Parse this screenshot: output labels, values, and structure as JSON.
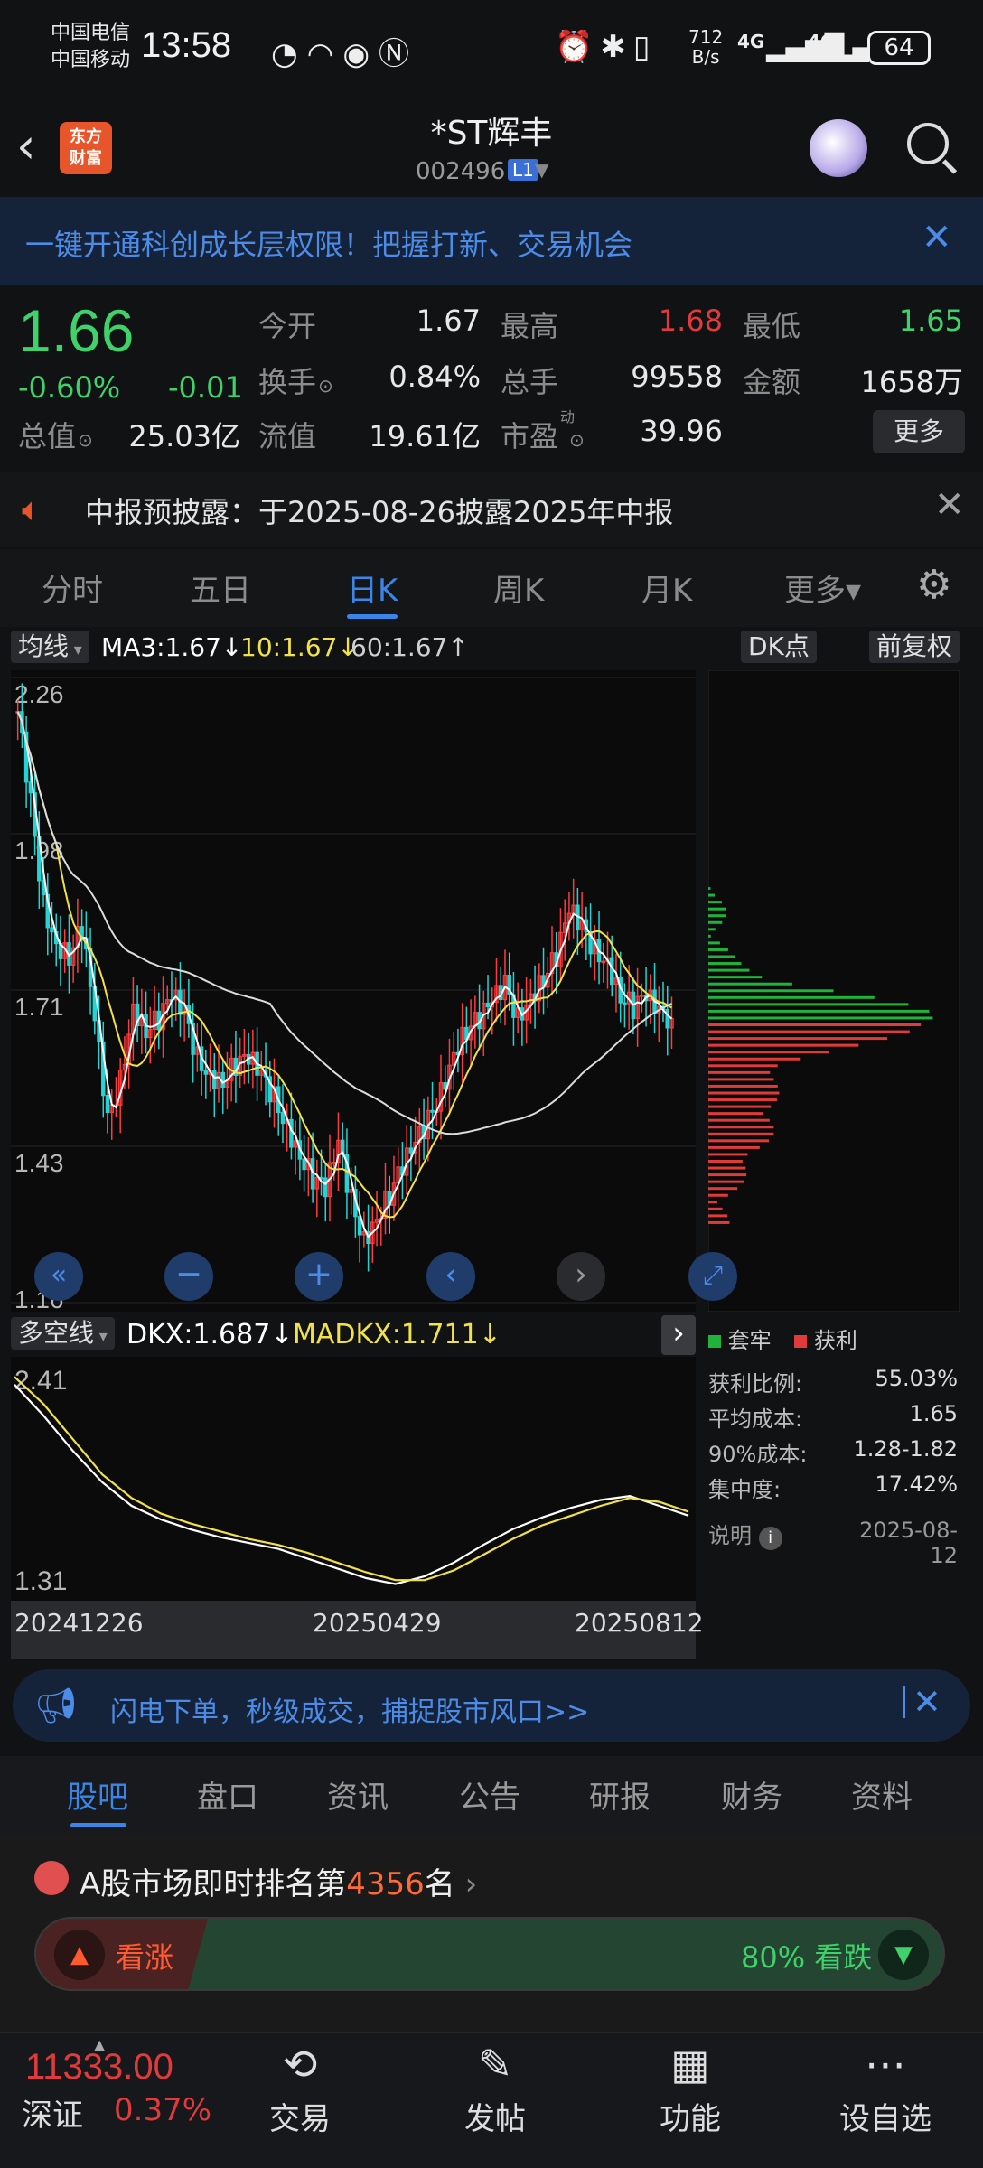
{
  "status_bar": {
    "carrier1": "中国电信",
    "carrier2": "中国移动",
    "time": "13:58",
    "net_speed_top": "712",
    "net_speed_bottom": "B/s",
    "net1": "4G",
    "net2": "4G",
    "battery": "64"
  },
  "header": {
    "back_icon": "chevron-left-icon",
    "logo_line1": "东方",
    "logo_line2": "财富",
    "stock_name": "*ST辉丰",
    "stock_code": "002496",
    "level_badge": "L1"
  },
  "banner": {
    "text": "一键开通科创成长层权限！把握打新、交易机会",
    "close": "✕"
  },
  "quote": {
    "price": "1.66",
    "change_pct": "-0.60%",
    "change": "-0.01",
    "fields": [
      {
        "label": "今开",
        "value": "1.67",
        "color": "#e8e8e8"
      },
      {
        "label": "最高",
        "value": "1.68",
        "color": "#e03a3a"
      },
      {
        "label": "最低",
        "value": "1.65",
        "color": "#3fd16a"
      },
      {
        "label": "换手",
        "value": "0.84%",
        "color": "#e8e8e8"
      },
      {
        "label": "总手",
        "value": "99558",
        "color": "#e8e8e8"
      },
      {
        "label": "金额",
        "value": "1658万",
        "color": "#e8e8e8"
      },
      {
        "label": "总值",
        "value": "25.03亿",
        "color": "#e8e8e8"
      },
      {
        "label": "流值",
        "value": "19.61亿",
        "color": "#e8e8e8"
      },
      {
        "label": "市盈",
        "value": "39.96",
        "color": "#e8e8e8"
      }
    ],
    "pe_superscript": "动",
    "more": "更多"
  },
  "notice": {
    "text": "中报预披露：于2025-08-26披露2025年中报",
    "close": "✕"
  },
  "tabs": [
    "分时",
    "五日",
    "日K",
    "周K",
    "月K",
    "更多▾"
  ],
  "active_tab": "日K",
  "chart_toolbar": {
    "ma_select": "均线",
    "ma3": "MA3:1.67↓",
    "ma10": "10:1.67↓",
    "ma60": "60:1.67↑",
    "dk_chip": "DK点",
    "restore_chip": "前复权"
  },
  "chart_data": [
    {
      "type": "candlestick",
      "title": "",
      "y_tick_labels": [
        "2.26",
        "1.98",
        "1.71",
        "1.43",
        "1.16"
      ],
      "ylim": [
        1.16,
        2.26
      ],
      "series_ma": [
        {
          "name": "MA3",
          "value": 1.67,
          "color": "#ffffff"
        },
        {
          "name": "10",
          "value": 1.67,
          "color": "#f2e24a"
        },
        {
          "name": "60",
          "value": 1.67,
          "color": "#dcdcdc"
        }
      ],
      "x_tick_labels": [
        "20241226",
        "20250429",
        "20250812"
      ],
      "close_trend": [
        2.2,
        2.04,
        1.86,
        1.79,
        1.77,
        1.82,
        1.66,
        1.48,
        1.55,
        1.68,
        1.64,
        1.66,
        1.7,
        1.67,
        1.59,
        1.56,
        1.55,
        1.58,
        1.59,
        1.56,
        1.52,
        1.47,
        1.42,
        1.38,
        1.36,
        1.44,
        1.34,
        1.27,
        1.31,
        1.35,
        1.4,
        1.44,
        1.48,
        1.53,
        1.6,
        1.64,
        1.66,
        1.69,
        1.72,
        1.66,
        1.7,
        1.73,
        1.77,
        1.85,
        1.82,
        1.78,
        1.76,
        1.7,
        1.68,
        1.7,
        1.67,
        1.66
      ],
      "legend": "grid on"
    },
    {
      "type": "line",
      "title": "",
      "indicator_select": "多空线",
      "dkx": "DKX:1.687↓",
      "madkx": "MADKX:1.711↓",
      "y_tick_labels": [
        "2.41",
        "1.31"
      ],
      "ylim": [
        1.31,
        2.41
      ],
      "series": [
        {
          "name": "DKX",
          "values": [
            2.36,
            2.2,
            2.02,
            1.86,
            1.74,
            1.67,
            1.62,
            1.58,
            1.55,
            1.52,
            1.47,
            1.42,
            1.37,
            1.34,
            1.38,
            1.45,
            1.54,
            1.62,
            1.68,
            1.73,
            1.77,
            1.79,
            1.74,
            1.69
          ]
        },
        {
          "name": "MADKX",
          "values": [
            2.4,
            2.26,
            2.08,
            1.9,
            1.78,
            1.7,
            1.65,
            1.61,
            1.57,
            1.54,
            1.5,
            1.45,
            1.4,
            1.36,
            1.36,
            1.41,
            1.49,
            1.57,
            1.64,
            1.69,
            1.74,
            1.78,
            1.76,
            1.71
          ]
        }
      ]
    },
    {
      "type": "bar",
      "title": "",
      "legend": [
        {
          "name": "套牢",
          "color": "#1fb33a"
        },
        {
          "name": "获利",
          "color": "#e03a3a"
        }
      ],
      "stats": [
        {
          "label": "获利比例:",
          "value": "55.03%"
        },
        {
          "label": "平均成本:",
          "value": "1.65"
        },
        {
          "label": "90%成本:",
          "value": "1.28-1.82"
        },
        {
          "label": "集中度:",
          "value": "17.42%"
        }
      ],
      "explain": "说明",
      "date": "2025-08-12"
    }
  ],
  "promo": {
    "text": "闪电下单，秒级成交，捕捉股市风口>>",
    "close": "✕"
  },
  "bottom_tabs": [
    "股吧",
    "盘口",
    "资讯",
    "公告",
    "研报",
    "财务",
    "资料"
  ],
  "rank": {
    "prefix": "A股市场即时排名第",
    "number": "4356",
    "suffix": "名",
    "chevron": "›",
    "up_label": "看涨",
    "down_label": "80% 看跌",
    "up_share": 0.2
  },
  "bottom_bar": {
    "index_value": "11333.00",
    "index_name": "深证",
    "index_pct": "0.37%",
    "nav": [
      {
        "label": "交易",
        "icon": "yen-cycle-icon"
      },
      {
        "label": "发帖",
        "icon": "edit-icon"
      },
      {
        "label": "功能",
        "icon": "grid-icon"
      },
      {
        "label": "设自选",
        "icon": "more-circle-icon"
      }
    ]
  }
}
